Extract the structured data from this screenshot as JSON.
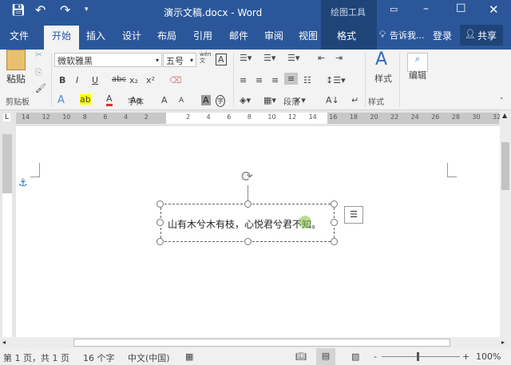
{
  "title": {
    "doc": "演示文稿.docx - Word",
    "context": "绘图工具",
    "undo": "↶",
    "redo": "↷"
  },
  "tabs": [
    {
      "label": "文件"
    },
    {
      "label": "开始"
    },
    {
      "label": "插入"
    },
    {
      "label": "设计"
    },
    {
      "label": "布局"
    },
    {
      "label": "引用"
    },
    {
      "label": "邮件"
    },
    {
      "label": "审阅"
    },
    {
      "label": "视图"
    },
    {
      "label": "格式"
    }
  ],
  "tell_me": "告诉我...",
  "login": "登录",
  "share": "共享",
  "ribbon": {
    "paste": "粘贴",
    "font_name": "微软雅黑",
    "font_size": "五号",
    "groups": {
      "clipboard": "剪贴板",
      "font": "字体",
      "paragraph": "段落",
      "styles": "样式"
    },
    "styles_btn": "样式",
    "edit_btn": "编辑",
    "bold": "B",
    "italic": "I",
    "underline": "U",
    "strike": "abc",
    "sub": "x₂",
    "sup": "x²",
    "grow": "A",
    "shrink": "A",
    "case": "Aa",
    "phonetic": "wén 文",
    "charborder": "A",
    "charshade": "A",
    "enclose": "字"
  },
  "ruler": {
    "left": [
      "14",
      "12",
      "10",
      "8",
      "6",
      "4",
      "2"
    ],
    "right": [
      "2",
      "4",
      "6",
      "8",
      "10",
      "12",
      "14",
      "16",
      "18",
      "20",
      "22",
      "24",
      "26",
      "28",
      "30",
      "32"
    ],
    "tab_stop": "L"
  },
  "textbox": {
    "text": "山有木兮木有枝，心悦君兮君不知。"
  },
  "status": {
    "page": "第 1 页，共 1 页",
    "words": "16 个字",
    "lang": "中文(中国)",
    "zoom": "100%"
  },
  "colors": {
    "brand": "#2b579a",
    "context_tab": "#1e4478"
  }
}
